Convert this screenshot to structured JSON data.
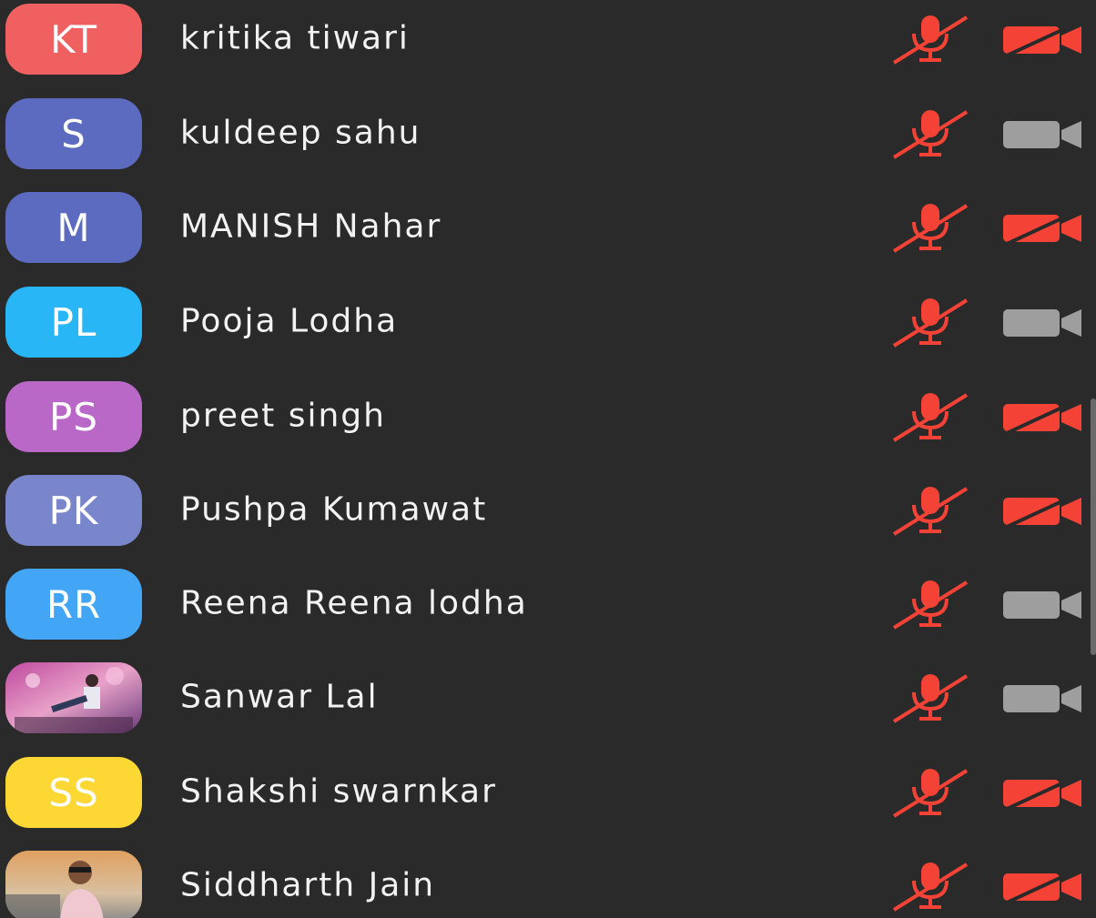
{
  "colors": {
    "background": "#2a2a2a",
    "muted_red": "#f44336",
    "camera_on_gray": "#9e9e9e"
  },
  "participants": [
    {
      "initials": "KT",
      "name": "kritika tiwari",
      "avatar_color": "#f06060",
      "avatar_type": "initials",
      "mic_muted": true,
      "camera_off": true
    },
    {
      "initials": "S",
      "name": "kuldeep sahu",
      "avatar_color": "#5c6bc0",
      "avatar_type": "initials",
      "mic_muted": true,
      "camera_off": false
    },
    {
      "initials": "M",
      "name": "MANISH Nahar",
      "avatar_color": "#5c6bc0",
      "avatar_type": "initials",
      "mic_muted": true,
      "camera_off": true
    },
    {
      "initials": "PL",
      "name": "Pooja Lodha",
      "avatar_color": "#29b6f6",
      "avatar_type": "initials",
      "mic_muted": true,
      "camera_off": false
    },
    {
      "initials": "PS",
      "name": "preet singh",
      "avatar_color": "#ba68c8",
      "avatar_type": "initials",
      "mic_muted": true,
      "camera_off": true
    },
    {
      "initials": "PK",
      "name": "Pushpa Kumawat",
      "avatar_color": "#7986cb",
      "avatar_type": "initials",
      "mic_muted": true,
      "camera_off": true
    },
    {
      "initials": "RR",
      "name": "Reena Reena lodha",
      "avatar_color": "#42a5f5",
      "avatar_type": "initials",
      "mic_muted": true,
      "camera_off": false
    },
    {
      "initials": "",
      "name": "Sanwar Lal",
      "avatar_color": "#8e5a8a",
      "avatar_type": "photo",
      "mic_muted": true,
      "camera_off": false
    },
    {
      "initials": "SS",
      "name": "Shakshi swarnkar",
      "avatar_color": "#fdd835",
      "avatar_type": "initials",
      "mic_muted": true,
      "camera_off": true
    },
    {
      "initials": "",
      "name": "Siddharth Jain",
      "avatar_color": "#c9a06a",
      "avatar_type": "photo",
      "mic_muted": true,
      "camera_off": true
    }
  ]
}
